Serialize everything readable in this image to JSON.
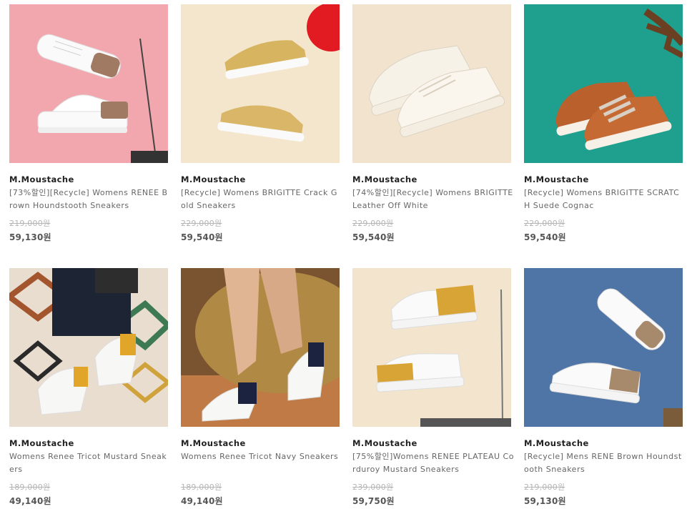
{
  "products": [
    {
      "brand": "M.Moustache",
      "name": "[73%할인][Recycle] Womens RENEE Brown Houndstooth Sneakers",
      "original_price": "219,000원",
      "price": "59,130원",
      "bg": "#f2a7ae"
    },
    {
      "brand": "M.Moustache",
      "name": "[Recycle] Womens BRIGITTE Crack Gold Sneakers",
      "original_price": "229,000원",
      "price": "59,540원",
      "bg": "#f3e6cc"
    },
    {
      "brand": "M.Moustache",
      "name": "[74%할인][Recycle] Womens BRIGITTE Leather Off White",
      "original_price": "229,000원",
      "price": "59,540원",
      "bg": "#f1e3cd"
    },
    {
      "brand": "M.Moustache",
      "name": "[Recycle] Womens BRIGITTE SCRATCH Suede Cognac",
      "original_price": "229,000원",
      "price": "59,540원",
      "bg": "#1f9f8d"
    },
    {
      "brand": "M.Moustache",
      "name": "Womens Renee Tricot Mustard Sneakers",
      "original_price": "189,000원",
      "price": "49,140원",
      "bg": "#e9ddd0"
    },
    {
      "brand": "M.Moustache",
      "name": "Womens Renee Tricot Navy Sneakers",
      "original_price": "189,000원",
      "price": "49,140원",
      "bg": "#7a5330"
    },
    {
      "brand": "M.Moustache",
      "name": "[75%할인]Womens RENEE PLATEAU Corduroy Mustard Sneakers",
      "original_price": "239,000원",
      "price": "59,750원",
      "bg": "#f2e4cd"
    },
    {
      "brand": "M.Moustache",
      "name": "[Recycle] Mens RENE Brown Houndstooth Sneakers",
      "original_price": "219,000원",
      "price": "59,130원",
      "bg": "#4f74a6"
    }
  ]
}
